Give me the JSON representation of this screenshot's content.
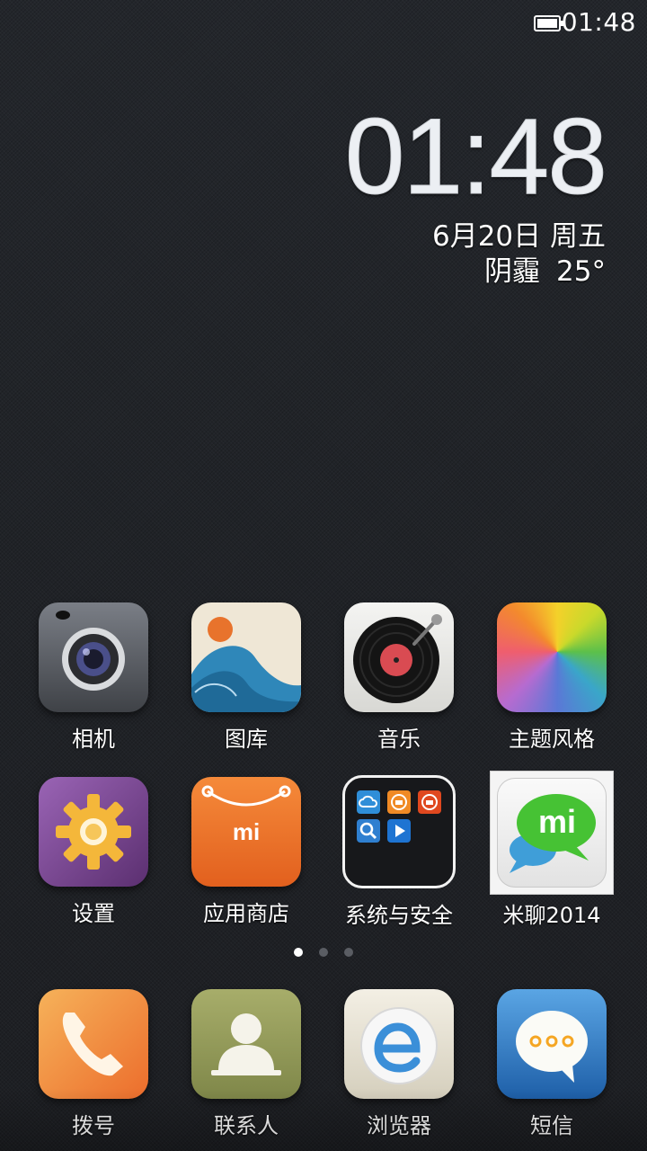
{
  "status_bar": {
    "time": "01:48"
  },
  "clock_widget": {
    "time": "01:48",
    "date": "6月20日 周五",
    "weather": "阴霾",
    "temperature": "25°"
  },
  "apps_row1": [
    {
      "label": "相机"
    },
    {
      "label": "图库"
    },
    {
      "label": "音乐"
    },
    {
      "label": "主题风格"
    }
  ],
  "apps_row2": [
    {
      "label": "设置"
    },
    {
      "label": "应用商店"
    },
    {
      "label": "系统与安全"
    },
    {
      "label": "米聊2014"
    }
  ],
  "store_logo": "mi",
  "mitalk_logo": "mi",
  "page_indicator": {
    "count": 3,
    "active": 1
  },
  "dock": [
    {
      "label": "拨号"
    },
    {
      "label": "联系人"
    },
    {
      "label": "浏览器"
    },
    {
      "label": "短信"
    }
  ],
  "colors": {
    "accent_orange": "#f07a2a",
    "mitalk_green": "#3fbf2e"
  }
}
